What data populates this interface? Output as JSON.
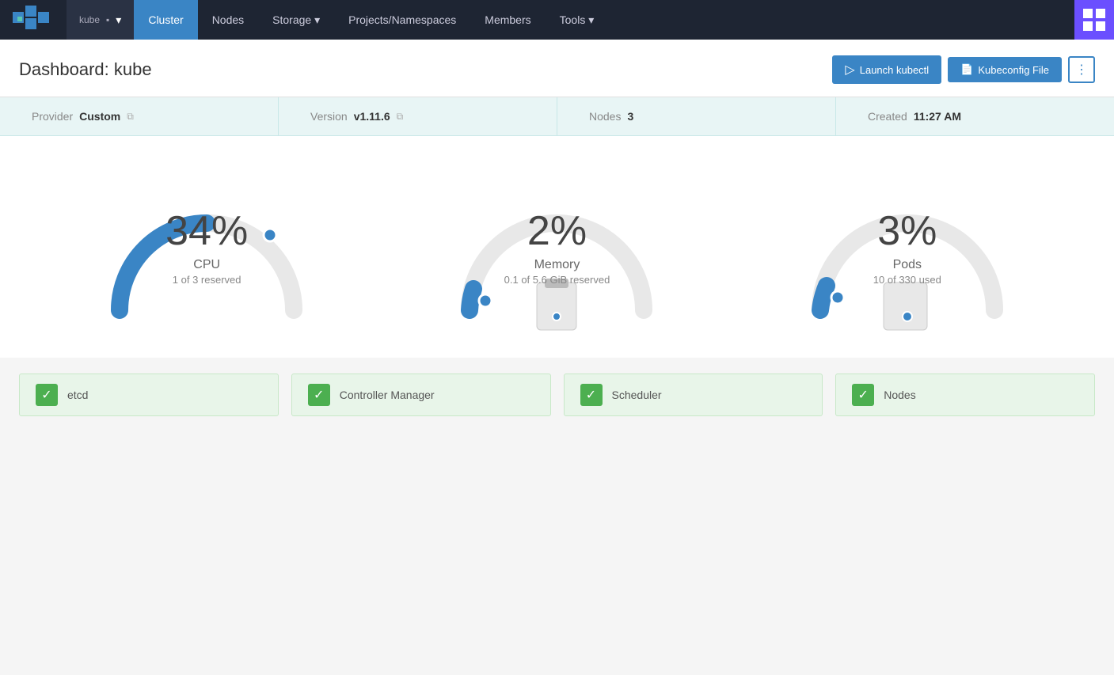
{
  "nav": {
    "cluster_name": "kube",
    "items": [
      {
        "label": "Cluster",
        "active": true
      },
      {
        "label": "Nodes",
        "active": false
      },
      {
        "label": "Storage",
        "active": false,
        "dropdown": true
      },
      {
        "label": "Projects/Namespaces",
        "active": false
      },
      {
        "label": "Members",
        "active": false
      },
      {
        "label": "Tools",
        "active": false,
        "dropdown": true
      }
    ]
  },
  "header": {
    "title": "Dashboard: kube",
    "launch_kubectl_label": "Launch kubectl",
    "kubeconfig_file_label": "Kubeconfig File"
  },
  "info_bar": {
    "provider_label": "Provider",
    "provider_value": "Custom",
    "version_label": "Version",
    "version_value": "v1.11.6",
    "nodes_label": "Nodes",
    "nodes_value": "3",
    "created_label": "Created",
    "created_value": "11:27 AM"
  },
  "gauges": [
    {
      "id": "cpu",
      "pct": "34%",
      "label": "CPU",
      "sublabel": "1 of 3 reserved",
      "fill_ratio": 0.34,
      "color": "#3a85c5"
    },
    {
      "id": "memory",
      "pct": "2%",
      "label": "Memory",
      "sublabel": "0.1 of 5.6 GiB reserved",
      "fill_ratio": 0.02,
      "color": "#3a85c5"
    },
    {
      "id": "pods",
      "pct": "3%",
      "label": "Pods",
      "sublabel": "10 of 330 used",
      "fill_ratio": 0.03,
      "color": "#3a85c5"
    }
  ],
  "status_items": [
    {
      "id": "etcd",
      "label": "etcd"
    },
    {
      "id": "controller-manager",
      "label": "Controller Manager"
    },
    {
      "id": "scheduler",
      "label": "Scheduler"
    },
    {
      "id": "nodes",
      "label": "Nodes"
    }
  ]
}
